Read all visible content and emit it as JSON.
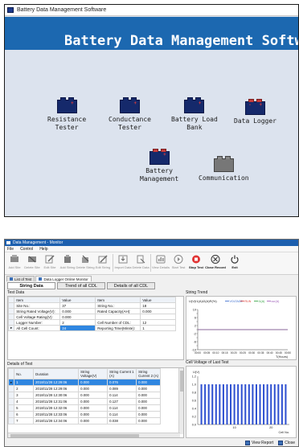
{
  "app1": {
    "title": "Battery Data Management Software",
    "banner": "Battery Data Management Software",
    "devices": [
      {
        "lines": [
          "Resistance",
          "Tester"
        ]
      },
      {
        "lines": [
          "Conductance",
          "Tester"
        ]
      },
      {
        "lines": [
          "Battery Load",
          "Bank"
        ]
      },
      {
        "lines": [
          "Data Logger"
        ]
      },
      {
        "lines": [
          "Battery",
          "Management"
        ]
      },
      {
        "lines": [
          "Communication"
        ]
      }
    ]
  },
  "app2": {
    "title": "Data Management - Monitor",
    "menu": [
      "File",
      "Control",
      "Help"
    ],
    "toolbar": [
      {
        "label": "Add Site",
        "icon": "add-site-icon",
        "enabled": false
      },
      {
        "label": "Delete Site",
        "icon": "delete-site-icon",
        "enabled": false
      },
      {
        "label": "Edit Site",
        "icon": "edit-site-icon",
        "enabled": false
      },
      {
        "label": "Add String",
        "icon": "add-string-icon",
        "enabled": false
      },
      {
        "label": "Delete String",
        "icon": "delete-string-icon",
        "enabled": false
      },
      {
        "label": "Edit String",
        "icon": "edit-string-icon",
        "enabled": false
      },
      {
        "label": "Import Data",
        "icon": "import-data-icon",
        "enabled": false
      },
      {
        "label": "Delete Data",
        "icon": "delete-data-icon",
        "enabled": false
      },
      {
        "label": "View Details",
        "icon": "view-details-icon",
        "enabled": false
      },
      {
        "label": "Start Test",
        "icon": "start-test-icon",
        "enabled": false
      },
      {
        "label": "Stop Test",
        "icon": "stop-test-icon",
        "enabled": true
      },
      {
        "label": "Close Record",
        "icon": "close-record-icon",
        "enabled": true
      },
      {
        "label": "Exit",
        "icon": "exit-icon",
        "enabled": true
      }
    ],
    "doc_tabs": [
      "List of Test",
      "Data Logger Online Monitor"
    ],
    "sub_tabs": [
      "String Data",
      "Trend of all CDL",
      "Details of all CDL"
    ],
    "test_data": {
      "title": "Test Data",
      "headers": [
        "Item",
        "Value",
        "Item",
        "Value"
      ],
      "rows": [
        [
          "Site No.:",
          "37",
          "String No.:",
          "18"
        ],
        [
          "String Rated Voltage(V):",
          "0.000",
          "Rated Capacity(AH):",
          "0.000"
        ],
        [
          "Cell Voltage Rating(V):",
          "0.000",
          "",
          ""
        ],
        [
          "Logger Number:",
          "2",
          "Cell Number of CDL:",
          "12"
        ],
        [
          "All Cell Count:",
          "24",
          "Reporting Time(Minite):",
          "1"
        ]
      ]
    },
    "details": {
      "title": "Details of Test",
      "headers": [
        "No.",
        "Duration",
        "String Voltage(V)",
        "String Current 1 (A)",
        "String Current 2 (A)"
      ],
      "rows": [
        [
          "1",
          "2018/11/28 12:29:06",
          "0.000",
          "0.076",
          "0.000"
        ],
        [
          "2",
          "2018/11/28 12:29:06",
          "0.000",
          "0.089",
          "0.000"
        ],
        [
          "3",
          "2018/11/28 12:30:06",
          "0.000",
          "0.114",
          "0.000"
        ],
        [
          "4",
          "2018/11/28 12:31:06",
          "0.000",
          "0.127",
          "0.000"
        ],
        [
          "5",
          "2018/11/28 12:32:06",
          "0.000",
          "0.114",
          "0.000"
        ],
        [
          "6",
          "2018/11/28 12:33:06",
          "0.000",
          "0.114",
          "0.000"
        ],
        [
          "7",
          "2018/11/28 12:34:06",
          "0.000",
          "0.038",
          "0.000"
        ]
      ]
    },
    "string_trend": {
      "title": "String Trend",
      "legend_prefix": "U(V)I1(A)I2(A)R(%)",
      "legend": [
        "VOLTAGE",
        "RUN",
        "I1(A)",
        "cur(A)"
      ],
      "x_label": "T(Hours)",
      "x_ticks": [
        "00:00",
        "00:05",
        "00:10",
        "00:15",
        "00:20",
        "00:25",
        "00:30",
        "00:35",
        "00:40",
        "00:45",
        "00:50"
      ]
    },
    "cell_voltage": {
      "title": "Cell Voltage of Last Test",
      "y_label": "U(V)",
      "x_label": "Cell No."
    },
    "footer": [
      "View Report",
      "Close"
    ]
  },
  "chart_data": [
    {
      "type": "line",
      "title": "String Trend",
      "ylabel": "U(V)I1(A)I2(A)R(%)",
      "xlabel": "T(Hours)",
      "ylim": [
        -10,
        10
      ],
      "y_ticks": [
        10,
        8,
        6,
        4,
        2,
        0,
        -2,
        -4,
        -6,
        -8,
        -10
      ],
      "x": [
        "00:00",
        "00:05",
        "00:10",
        "00:15",
        "00:20",
        "00:25",
        "00:30",
        "00:35",
        "00:40",
        "00:45",
        "00:50"
      ],
      "series": [
        {
          "name": "VOLTAGE",
          "color": "#3366cc",
          "values": [
            0,
            0,
            0,
            0,
            0,
            0,
            0,
            0,
            0,
            0,
            0
          ]
        },
        {
          "name": "RUN",
          "color": "#e0443c",
          "values": [
            0,
            0,
            0,
            0,
            0,
            0,
            0,
            0,
            0,
            0,
            0
          ]
        },
        {
          "name": "I1(A)",
          "color": "#2e9e3c",
          "values": [
            0,
            0,
            0,
            0,
            0,
            0,
            0,
            0,
            0,
            0,
            0
          ]
        },
        {
          "name": "cur(A)",
          "color": "#9b59b6",
          "values": [
            0,
            0,
            0,
            0,
            0,
            0,
            0,
            0,
            0,
            0,
            0
          ]
        }
      ]
    },
    {
      "type": "bar",
      "title": "Cell Voltage of Last Test",
      "ylabel": "U(V)",
      "xlabel": "Cell No.",
      "ylim": [
        0,
        1.2
      ],
      "y_ticks": [
        1.2,
        1.0,
        0.8,
        0.6,
        0.4,
        0.2,
        0.0
      ],
      "x_ticks": [
        10,
        20
      ],
      "categories": [
        1,
        2,
        3,
        4,
        5,
        6,
        7,
        8,
        9,
        10,
        11,
        12,
        13,
        14,
        15,
        16,
        17,
        18,
        19,
        20,
        21,
        22,
        23,
        24
      ],
      "values": [
        1,
        1,
        1,
        1,
        1,
        1,
        1,
        1,
        1,
        1,
        1,
        1,
        1,
        1,
        1,
        1,
        1,
        1,
        1,
        1,
        1,
        1,
        1,
        1
      ],
      "color": "#2d4fd0"
    }
  ]
}
